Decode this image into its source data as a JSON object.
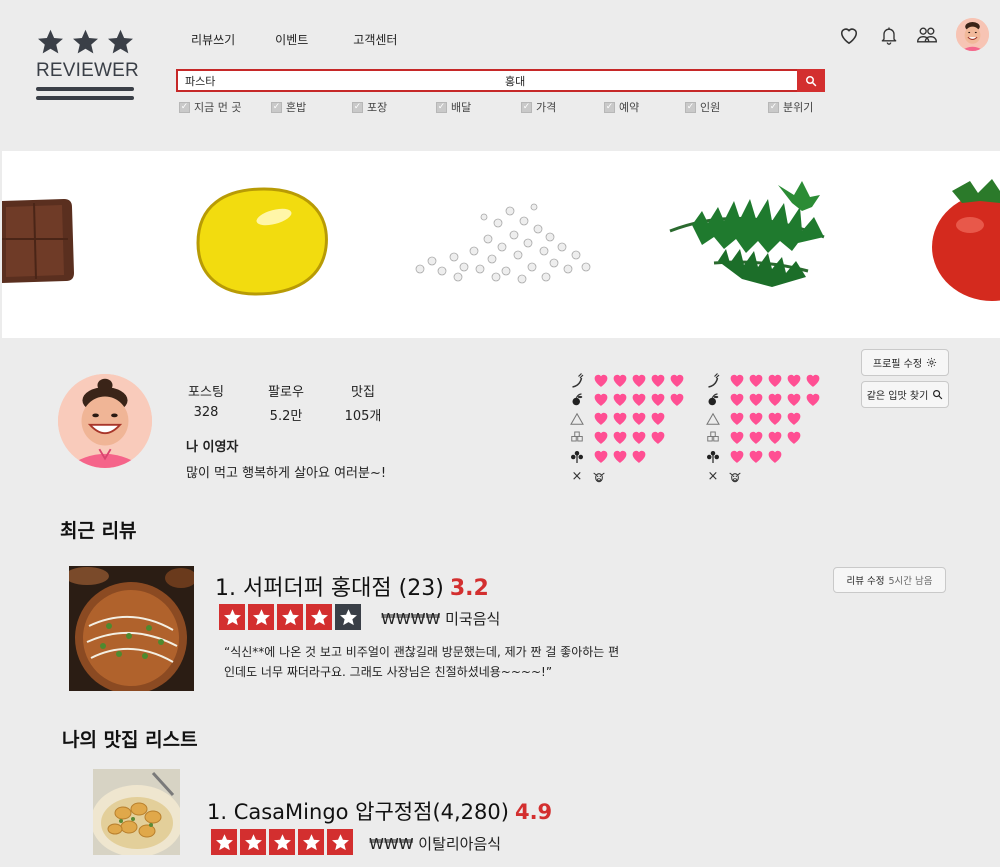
{
  "brand": {
    "name": "REVIEWER"
  },
  "nav": [
    "리뷰쓰기",
    "이벤트",
    "고객센터"
  ],
  "search": {
    "keyword": "파스타",
    "location": "홍대"
  },
  "filters": [
    "지금 먼 곳",
    "혼밥",
    "포장",
    "배달",
    "가격",
    "예약",
    "인원",
    "분위기"
  ],
  "header_icons": [
    "heart-icon",
    "bell-icon",
    "friends-icon",
    "avatar"
  ],
  "banner": {
    "items": [
      "chocolate",
      "lemon",
      "salt",
      "herbs",
      "tomato"
    ]
  },
  "profile": {
    "stats": [
      {
        "label": "포스팅",
        "value": "328"
      },
      {
        "label": "팔로우",
        "value": "5.2만"
      },
      {
        "label": "맛집",
        "value": "105개"
      }
    ],
    "name": "나 이영자",
    "bio": "많이 먹고 행복하게 살아요 여러분~!",
    "edit_button": "프로필 수정",
    "match_button": "같은 입맛 찾기",
    "taste_rows": [
      {
        "icon": "pepper-icon",
        "count": 5
      },
      {
        "icon": "olive-icon",
        "count": 5
      },
      {
        "icon": "salt-icon",
        "count": 4
      },
      {
        "icon": "sugar-icon",
        "count": 4
      },
      {
        "icon": "herb-icon",
        "count": 3
      }
    ],
    "taste_dislike": [
      "×",
      "cow-icon"
    ]
  },
  "recent_reviews": {
    "title": "최근 리뷰",
    "item": {
      "title": "1. 서퍼더퍼 홍대점 (23)",
      "score": "3.2",
      "stars": 4,
      "price": "₩₩₩₩",
      "category": "미국음식",
      "text_line1": "“식신**에 나온 것 보고 비주얼이 괜찮길래 방문했는데, 제가 짠 걸 좋아하는 편",
      "text_line2": "인데도 너무 짜더라구요. 그래도 사장님은 친절하셨네용~~~~!”",
      "edit_button_label": "리뷰 수정",
      "edit_button_time": "5시간 남음"
    }
  },
  "fav_list": {
    "title": "나의 맛집 리스트",
    "item": {
      "title": "1. CasaMingo 압구정점(4,280)",
      "score": "4.9",
      "stars": 5,
      "price": "₩₩₩",
      "category": "이탈리아음식"
    }
  },
  "colors": {
    "accent": "#d32f2f",
    "dark": "#3a3f47",
    "heart": "#ff4f93",
    "background": "#ececec"
  }
}
